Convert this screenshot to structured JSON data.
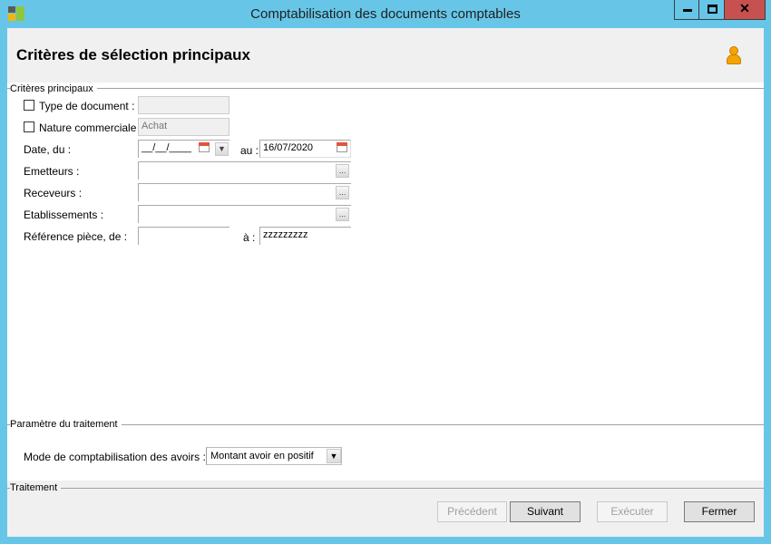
{
  "window": {
    "title": "Comptabilisation des documents comptables"
  },
  "header": {
    "title": "Critères de sélection principaux"
  },
  "criteria": {
    "group_label": "Critères principaux",
    "type_document": {
      "label": "Type de document :",
      "value": "",
      "checked": false
    },
    "nature_commerciale": {
      "label": "Nature commerciale :",
      "value": "Achat",
      "checked": false
    },
    "date": {
      "label": "Date, du :",
      "from_value": "__/__/____",
      "to_label": "au :",
      "to_value": "16/07/2020"
    },
    "emetteurs": {
      "label": "Emetteurs :",
      "value": "",
      "browse": "..."
    },
    "receveurs": {
      "label": "Receveurs :",
      "value": "",
      "browse": "..."
    },
    "etablissements": {
      "label": "Etablissements :",
      "value": "",
      "browse": "..."
    },
    "reference": {
      "label": "Référence pièce, de :",
      "from_value": "",
      "to_label": "à :",
      "to_value": "zzzzzzzzz"
    }
  },
  "params": {
    "group_label": "Paramètre du traitement",
    "mode_label": "Mode de comptabilisation des avoirs :",
    "mode_value": "Montant avoir en positif"
  },
  "treatment": {
    "group_label": "Traitement",
    "buttons": {
      "precedent": "Précédent",
      "suivant": "Suivant",
      "executer": "Exécuter",
      "fermer": "Fermer"
    }
  },
  "icons": {
    "window_min": "minimize-icon",
    "window_max": "maximize-icon",
    "window_close": "close-icon",
    "user": "user-icon",
    "calendar": "calendar-icon"
  },
  "colors": {
    "titlebar": "#67c6e8",
    "close_button": "#c75050",
    "accent_icon": "#f5a500"
  }
}
